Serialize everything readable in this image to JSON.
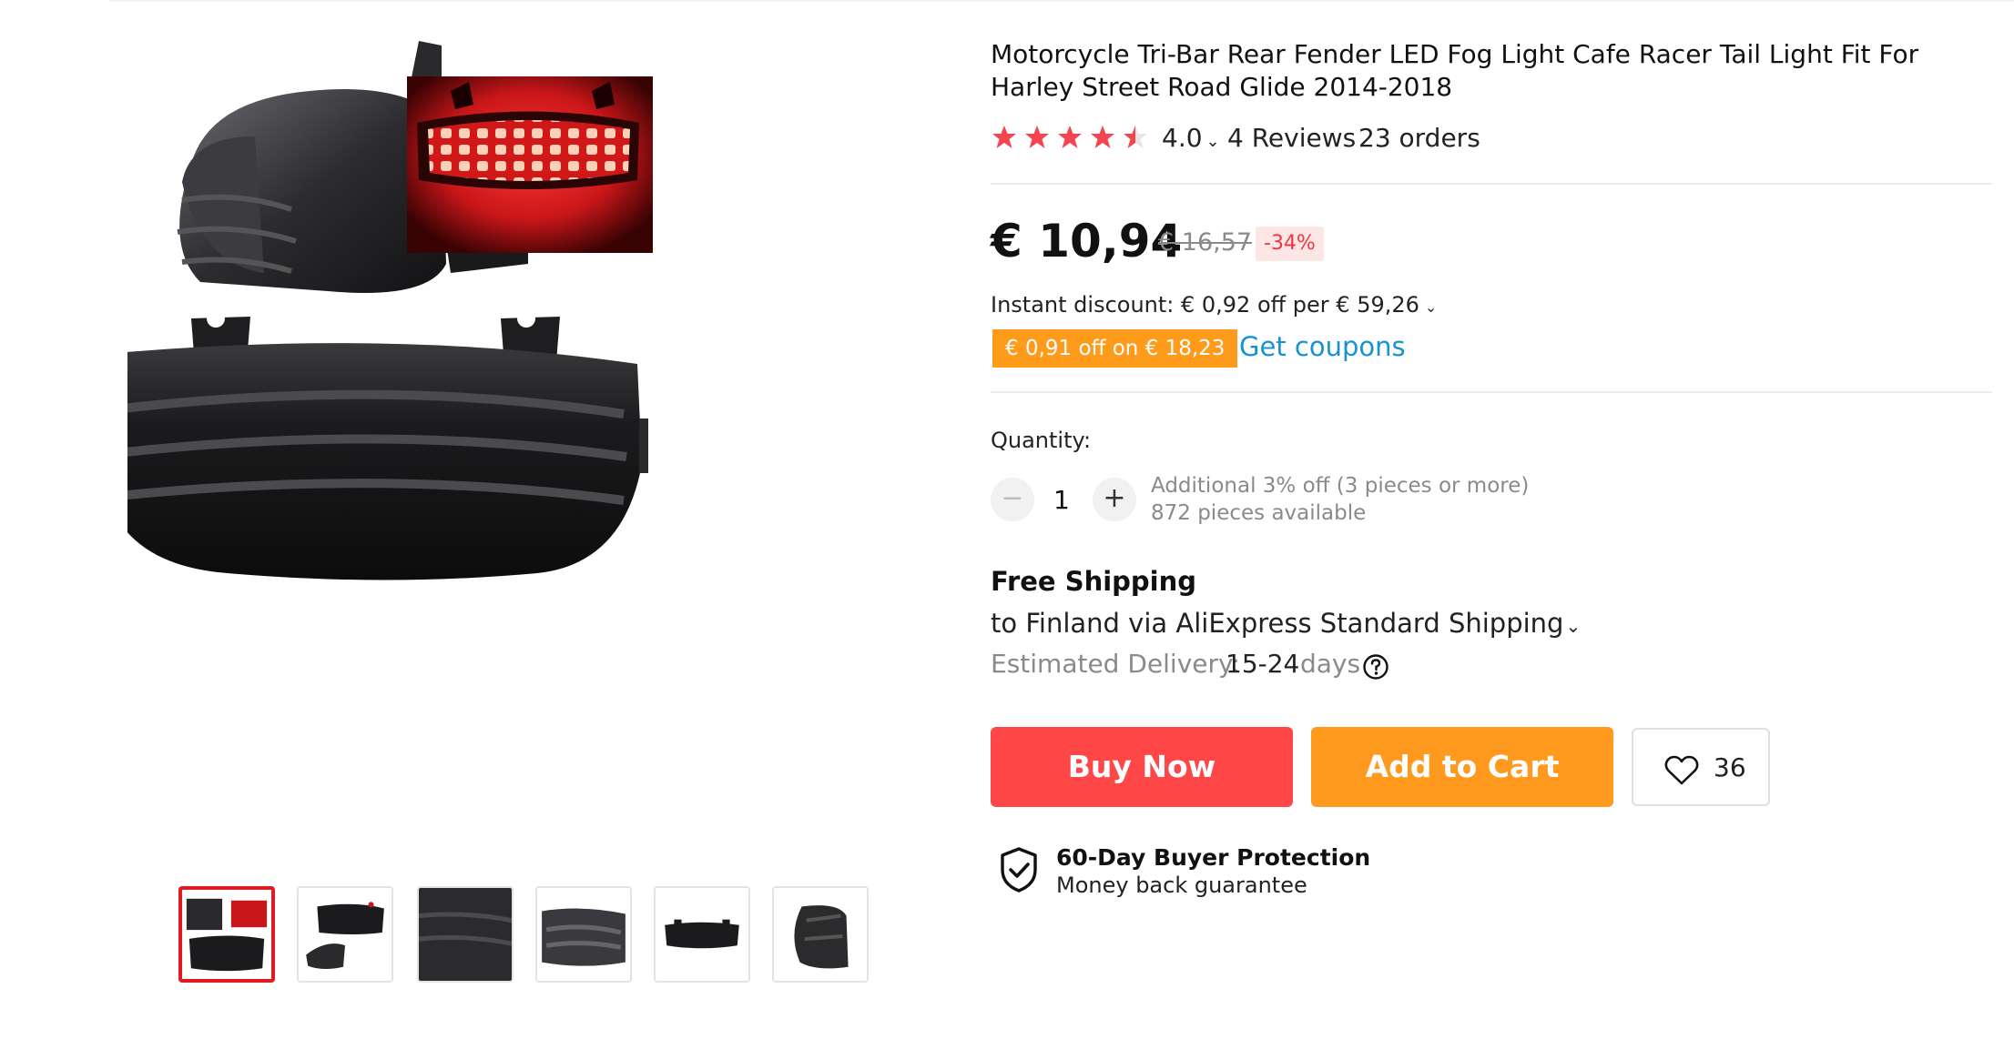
{
  "product": {
    "title": "Motorcycle Tri-Bar Rear Fender LED Fog Light Cafe Racer Tail Light Fit For Harley Street Road Glide 2014-2018",
    "rating": "4.0",
    "rating_value": 4.0,
    "reviews": "4 Reviews",
    "orders": "23 orders"
  },
  "price": {
    "current": "€ 10,94",
    "original": "€ 16,57",
    "discount": "-34%",
    "instant_discount": "Instant discount: € 0,92 off per € 59,26",
    "coupon": "€ 0,91 off on € 18,23",
    "get_coupons": "Get coupons"
  },
  "quantity": {
    "label": "Quantity:",
    "value": "1",
    "minus": "−",
    "plus": "+",
    "note": "Additional 3% off (3 pieces or more)",
    "available": "872 pieces available"
  },
  "shipping": {
    "title": "Free Shipping",
    "method": "to Finland via AliExpress Standard Shipping",
    "delivery_label": "Estimated Delivery:",
    "delivery_days": "15-24",
    "delivery_unit": "days"
  },
  "actions": {
    "buy_now": "Buy Now",
    "add_to_cart": "Add to Cart",
    "wishlist_count": "36"
  },
  "protection": {
    "title": "60-Day Buyer Protection",
    "subtitle": "Money back guarantee"
  },
  "gallery": {
    "thumbnails": [
      "thumb-1",
      "thumb-2",
      "thumb-3",
      "thumb-4",
      "thumb-5",
      "thumb-6"
    ],
    "active_index": 0
  },
  "colors": {
    "accent_red": "#ff4747",
    "accent_orange": "#ff9a1f",
    "link_blue": "#1793d1",
    "star_red": "#f5444f",
    "active_thumb_border": "#e01b22"
  },
  "icons": [
    "star-icon",
    "chevron-down-icon",
    "help-icon",
    "heart-icon",
    "shield-check-icon"
  ]
}
